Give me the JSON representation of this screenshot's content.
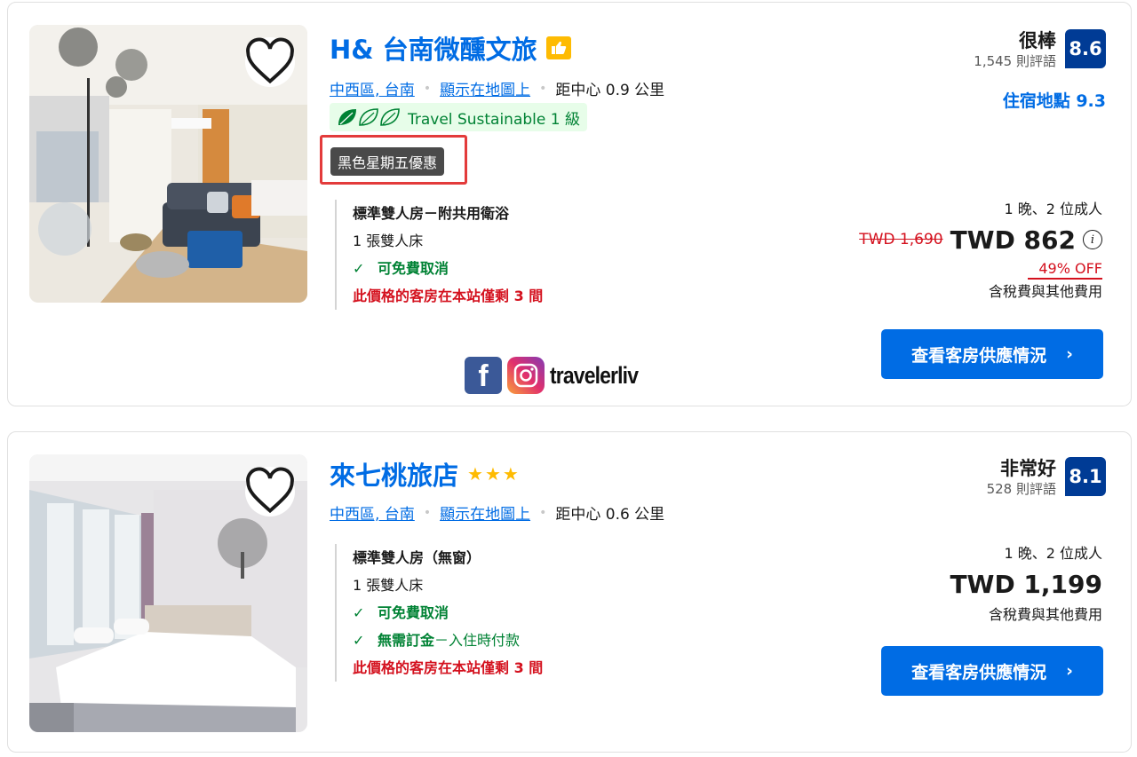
{
  "watermark": {
    "text": "travelerliv",
    "icons": [
      "facebook-icon",
      "instagram-icon"
    ]
  },
  "listings": [
    {
      "name": "H& 台南微醺文旅",
      "badge_icon": "thumbs-up-icon",
      "area_link": "中西區, 台南",
      "map_link": "顯示在地圖上",
      "distance": "距中心 0.9 公里",
      "sustainable": "Travel Sustainable 1 級",
      "promo": "黑色星期五優惠",
      "rating_word": "很棒",
      "review_count": "1,545 則評語",
      "score": "8.6",
      "location_score": "住宿地點 9.3",
      "room_type": "標準雙人房－附共用衛浴",
      "bed": "1 張雙人床",
      "free_cancel": "可免費取消",
      "scarcity": "此價格的客房在本站僅剩 3 間",
      "nights_guests": "1 晚、2 位成人",
      "old_price": "TWD 1,690",
      "price": "TWD 862",
      "discount": "49% OFF",
      "taxes": "含稅費與其他費用",
      "cta": "查看客房供應情況",
      "colors": {
        "accent": "#006ce4",
        "score_bg": "#003b95",
        "sale": "#d4111e",
        "green": "#008234"
      }
    },
    {
      "name": "來七桃旅店",
      "stars": "★★★",
      "area_link": "中西區, 台南",
      "map_link": "顯示在地圖上",
      "distance": "距中心 0.6 公里",
      "rating_word": "非常好",
      "review_count": "528 則評語",
      "score": "8.1",
      "room_type": "標準雙人房（無窗）",
      "bed": "1 張雙人床",
      "free_cancel": "可免費取消",
      "no_deposit": "無需訂金",
      "pay_at_property": "－入住時付款",
      "scarcity": "此價格的客房在本站僅剩 3 間",
      "nights_guests": "1 晚、2 位成人",
      "price": "TWD 1,199",
      "taxes": "含稅費與其他費用",
      "cta": "查看客房供應情況"
    }
  ]
}
